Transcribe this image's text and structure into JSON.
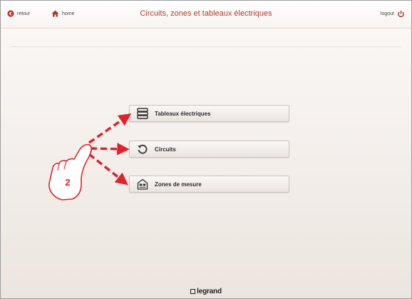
{
  "header": {
    "title": "Circuits, zones et tableaux électriques",
    "back_label": "retour",
    "home_label": "home",
    "logout_label": "logout"
  },
  "menu": [
    {
      "label": "Tableaux électriques",
      "icon": "panel-icon"
    },
    {
      "label": "Circuits",
      "icon": "circuit-arrow-icon"
    },
    {
      "label": "Zones de mesure",
      "icon": "measurement-zone-icon"
    }
  ],
  "annotation": {
    "step_number": "2",
    "arrow_color": "#e0222a"
  },
  "footer": {
    "brand": "legrand"
  },
  "colors": {
    "accent": "#b23b2d",
    "background": "#f3eeea"
  }
}
